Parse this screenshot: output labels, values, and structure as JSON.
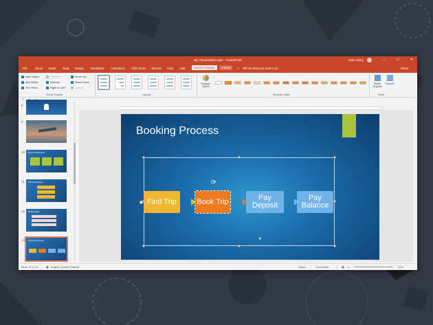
{
  "window": {
    "title": "My Presentation.pptx - PowerPoint",
    "user": "Deb Ashby",
    "controls": [
      "─",
      "▭",
      "✕"
    ]
  },
  "menu": {
    "tabs": [
      "File",
      "Home",
      "Insert",
      "Draw",
      "Design",
      "Transitions",
      "Animations",
      "Slide Show",
      "Review",
      "View",
      "Help"
    ],
    "context_tabs": [
      "SmartArt Design",
      "Format"
    ],
    "tell_me": "Tell me what you want to do",
    "share": "Share"
  },
  "ribbon": {
    "create_graphic": {
      "add_shape": "Add Shape",
      "add_bullet": "Add Bullet",
      "text_pane": "Text Pane",
      "promote": "Promote",
      "demote": "Demote",
      "right_to_left": "Right to Left",
      "move_up": "Move Up",
      "move_down": "Move Down",
      "layout": "Layout",
      "label": "Create Graphic"
    },
    "layouts_label": "Layouts",
    "change_colors": "Change Colors",
    "smartart_styles_label": "SmartArt Styles",
    "reset_graphic": "Reset Graphic",
    "convert": "Convert",
    "reset_label": "Reset"
  },
  "thumbnails": [
    {
      "num": "8",
      "text": ""
    },
    {
      "num": "9",
      "text": ""
    },
    {
      "num": "10",
      "text": "Board of Directors"
    },
    {
      "num": "11",
      "text": "Team Overview"
    },
    {
      "num": "12",
      "text": "Testimonials"
    },
    {
      "num": "13",
      "text": "Booking Process"
    }
  ],
  "slide": {
    "title": "Booking Process",
    "steps": [
      "Find Trip",
      "Book Trip",
      "Pay Deposit",
      "Pay Balance"
    ],
    "colors": {
      "find": "#f0b72f",
      "book": "#ef7a1e",
      "pay": "#6fb3ea",
      "accent_bar": "#a7c43a"
    }
  },
  "status": {
    "slide_counter": "Slide 13 of 13",
    "language": "English (United States)",
    "notes": "Notes",
    "comments": "Comments",
    "zoom": "67%"
  }
}
